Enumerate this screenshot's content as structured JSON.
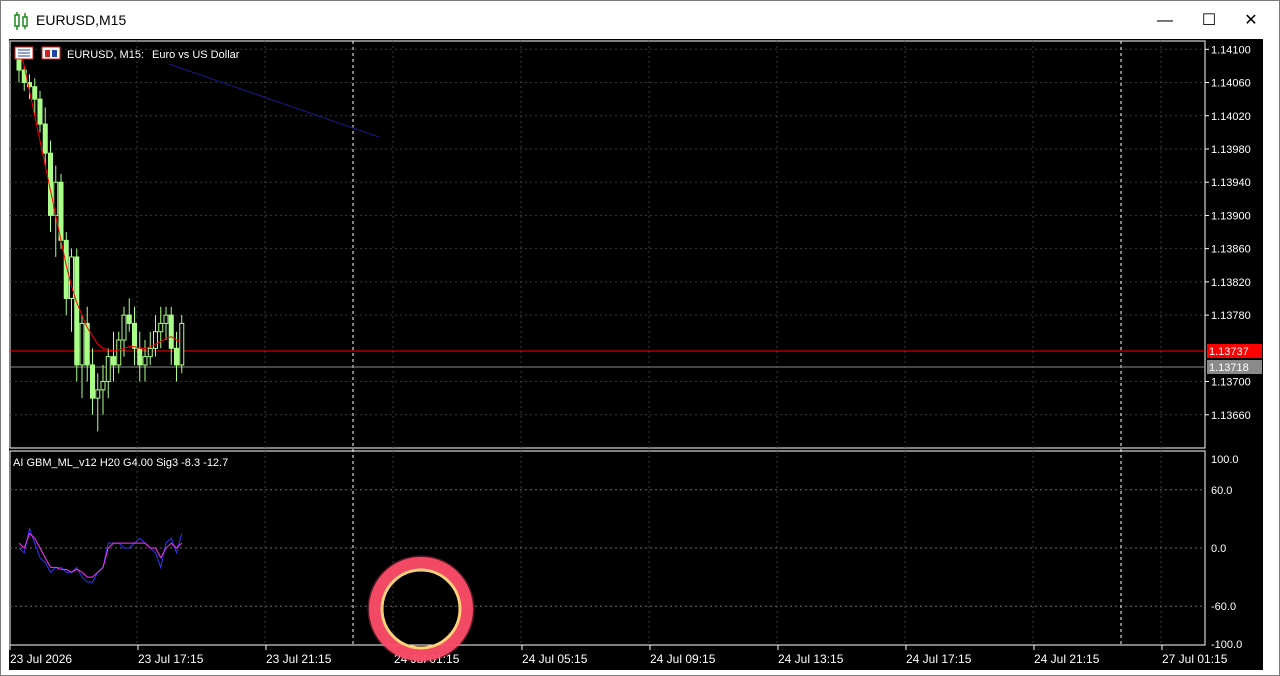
{
  "window": {
    "title": "EURUSD,M15",
    "minimize_glyph": "—",
    "maximize_glyph": "☐",
    "close_glyph": "✕"
  },
  "main_chart": {
    "symbol_label": "EURUSD, M15:",
    "description": "Euro vs US Dollar",
    "price_axis": [
      "1.14100",
      "1.14060",
      "1.14020",
      "1.13980",
      "1.13940",
      "1.13900",
      "1.13860",
      "1.13820",
      "1.13780",
      "1.13737",
      "1.13718",
      "1.13700",
      "1.13660"
    ],
    "bid_price": "1.13737",
    "ask_price": "1.13718",
    "colors": {
      "bull": "#aaff88",
      "bear": "#aaff88",
      "ma": "#ff0000",
      "ma_slow": "#1a1a8a",
      "bid_line": "#ff0000",
      "ask_line": "#8a8a8a",
      "bid_tag": "#ff0000",
      "ask_tag": "#8a8a8a"
    }
  },
  "indicator": {
    "label": "AI GBM_ML_v12 H20 G4.00 Sig3 -8.3 -12.7",
    "axis": [
      "100.0",
      "60.0",
      "0.0",
      "-60.0",
      "-100.0"
    ],
    "colors": {
      "line1": "#3333ff",
      "line2": "#ff33ff"
    }
  },
  "time_axis": [
    "23 Jul 2026",
    "23 Jul 17:15",
    "23 Jul 21:15",
    "24 Jul 01:15",
    "24 Jul 05:15",
    "24 Jul 09:15",
    "24 Jul 13:15",
    "24 Jul 17:15",
    "24 Jul 21:15",
    "27 Jul 01:15"
  ],
  "chart_data": {
    "type": "candlestick",
    "series": [
      {
        "name": "EURUSD, M15",
        "candles": [
          [
            1.1409,
            1.141,
            1.1406,
            1.14075
          ],
          [
            1.14075,
            1.1408,
            1.1405,
            1.1406
          ],
          [
            1.1406,
            1.1407,
            1.1404,
            1.14055
          ],
          [
            1.14055,
            1.14065,
            1.1402,
            1.1404
          ],
          [
            1.1404,
            1.1405,
            1.14,
            1.1401
          ],
          [
            1.1401,
            1.1403,
            1.1396,
            1.13975
          ],
          [
            1.13975,
            1.1399,
            1.1388,
            1.139
          ],
          [
            1.139,
            1.1396,
            1.1385,
            1.1394
          ],
          [
            1.1394,
            1.1395,
            1.1386,
            1.1387
          ],
          [
            1.1387,
            1.1388,
            1.1378,
            1.138
          ],
          [
            1.138,
            1.1386,
            1.1376,
            1.1385
          ],
          [
            1.1385,
            1.1386,
            1.137,
            1.1372
          ],
          [
            1.1372,
            1.1378,
            1.1368,
            1.1377
          ],
          [
            1.1377,
            1.1379,
            1.137,
            1.1372
          ],
          [
            1.1372,
            1.1374,
            1.1366,
            1.1368
          ],
          [
            1.1368,
            1.1371,
            1.1364,
            1.1369
          ],
          [
            1.1369,
            1.1372,
            1.1366,
            1.137
          ],
          [
            1.137,
            1.1374,
            1.1368,
            1.1373
          ],
          [
            1.1373,
            1.1376,
            1.137,
            1.1372
          ],
          [
            1.1372,
            1.1376,
            1.1371,
            1.1375
          ],
          [
            1.1375,
            1.1379,
            1.1373,
            1.1378
          ],
          [
            1.1378,
            1.138,
            1.1376,
            1.1377
          ],
          [
            1.1377,
            1.1379,
            1.1372,
            1.1374
          ],
          [
            1.1374,
            1.1376,
            1.137,
            1.1372
          ],
          [
            1.1372,
            1.1375,
            1.137,
            1.1373
          ],
          [
            1.1373,
            1.1376,
            1.1372,
            1.1374
          ],
          [
            1.1374,
            1.1378,
            1.1373,
            1.1376
          ],
          [
            1.1376,
            1.1379,
            1.1374,
            1.1377
          ],
          [
            1.1377,
            1.1379,
            1.1375,
            1.1378
          ],
          [
            1.1378,
            1.1379,
            1.1372,
            1.1374
          ],
          [
            1.1374,
            1.1376,
            1.137,
            1.1372
          ],
          [
            1.1372,
            1.1378,
            1.1371,
            1.1377
          ]
        ]
      },
      {
        "name": "MA fast",
        "values": [
          1.141,
          1.1408,
          1.1405,
          1.1402,
          1.1399,
          1.1396,
          1.1393,
          1.139,
          1.1387,
          1.1384,
          1.13815,
          1.13795,
          1.1378,
          1.13765,
          1.13755,
          1.13745,
          1.1374,
          1.13738,
          1.13737,
          1.13738,
          1.1374,
          1.13742,
          1.13742,
          1.1374,
          1.1374,
          1.13742,
          1.13745,
          1.13748,
          1.13752,
          1.13754,
          1.1375,
          1.13748
        ]
      },
      {
        "name": "indicator line 1",
        "values": [
          0,
          -5,
          20,
          5,
          -10,
          -15,
          -25,
          -20,
          -20,
          -25,
          -25,
          -20,
          -30,
          -35,
          -35,
          -25,
          -20,
          5,
          5,
          5,
          0,
          0,
          5,
          10,
          5,
          0,
          -5,
          -20,
          5,
          10,
          -5,
          15
        ]
      },
      {
        "name": "indicator line 2",
        "values": [
          5,
          0,
          15,
          10,
          0,
          -10,
          -20,
          -20,
          -22,
          -22,
          -25,
          -22,
          -25,
          -30,
          -30,
          -25,
          -20,
          0,
          5,
          5,
          5,
          5,
          5,
          5,
          5,
          0,
          0,
          -10,
          0,
          5,
          0,
          5
        ]
      }
    ],
    "y_range_price": [
      1.1362,
      1.1411
    ],
    "y_range_indicator": [
      -100,
      100
    ]
  }
}
